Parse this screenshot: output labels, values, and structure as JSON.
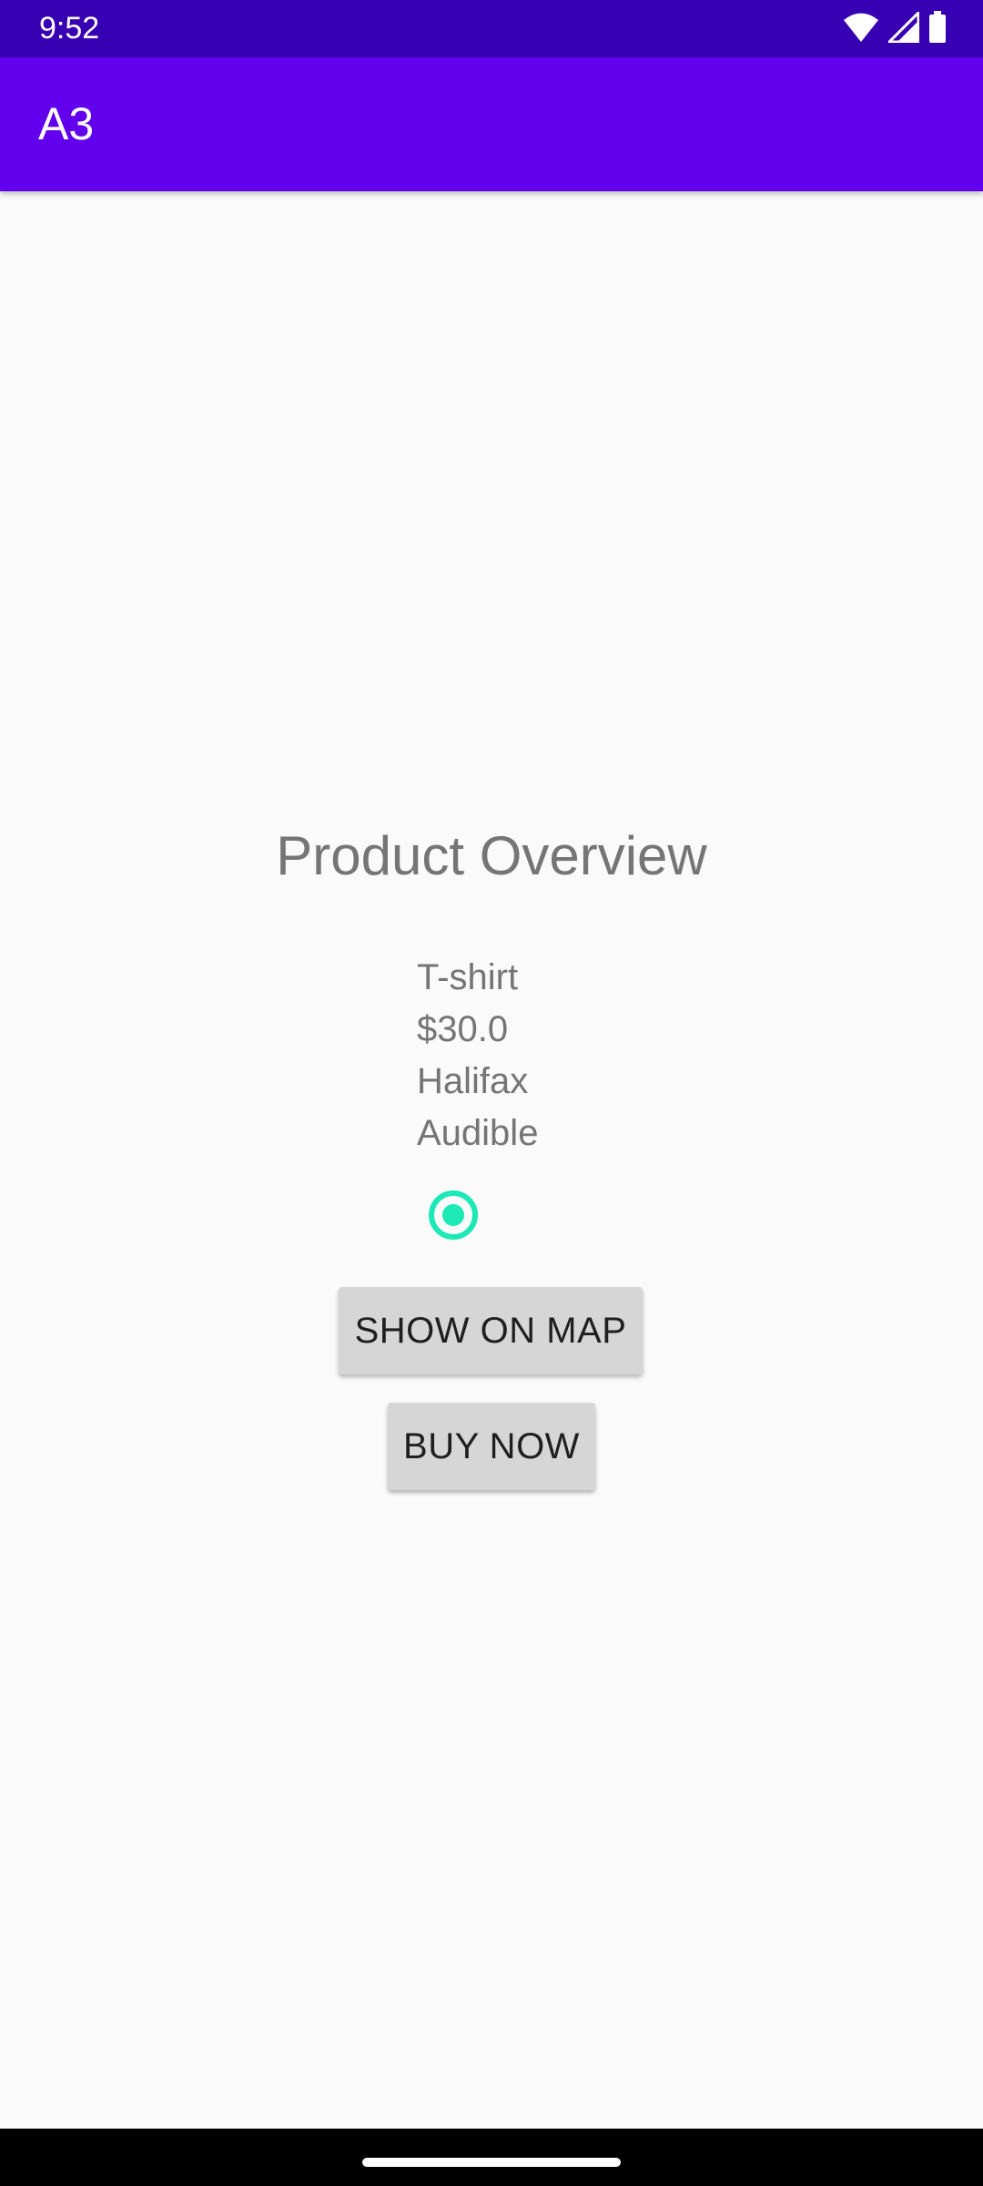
{
  "status_bar": {
    "time": "9:52",
    "icons": [
      "wifi-icon",
      "cellular-signal-icon",
      "battery-icon"
    ]
  },
  "app_bar": {
    "title": "A3",
    "color": "#6200ee"
  },
  "product": {
    "heading": "Product Overview",
    "name": "T-shirt",
    "price": "$30.0",
    "location": "Halifax",
    "brand": "Audible",
    "radio_selected": true
  },
  "actions": {
    "show_on_map": "SHOW ON MAP",
    "buy_now": "BUY NOW"
  },
  "colors": {
    "status_bar": "#3700b3",
    "app_bar": "#6200ee",
    "accent": "#1de9b6",
    "background": "#fafafa"
  }
}
